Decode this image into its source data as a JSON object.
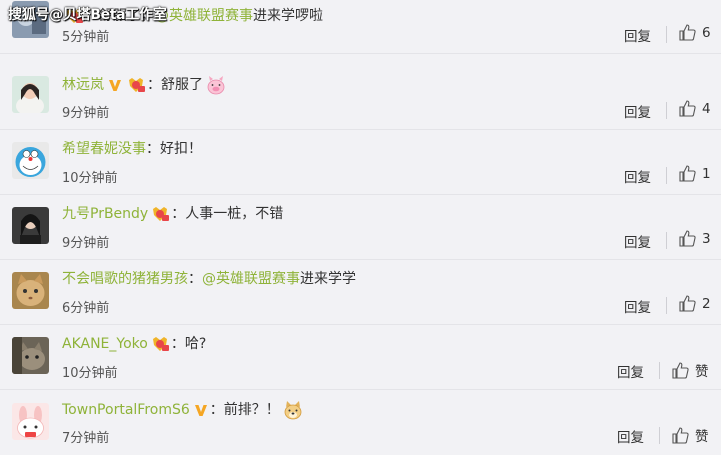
{
  "watermark": "搜狐号@贝塔Beta工作室",
  "reply_label": "回复",
  "comments": [
    {
      "user": "",
      "colon": "：",
      "content_pre": "舒服了，",
      "mention": "@英雄联盟赛事",
      "content_post": " 进来学啰啦",
      "time": "5分钟前",
      "likes": "6"
    },
    {
      "user": "林远岚",
      "colon": "：",
      "content_pre": "舒服了",
      "mention": "",
      "content_post": "",
      "time": "9分钟前",
      "likes": "4"
    },
    {
      "user": "希望春妮没事",
      "colon": "：",
      "content_pre": "好扣！",
      "mention": "",
      "content_post": "",
      "time": "10分钟前",
      "likes": "1"
    },
    {
      "user": "九号PrBendy",
      "colon": "：",
      "content_pre": "人事一桩，不错",
      "mention": "",
      "content_post": "",
      "time": "9分钟前",
      "likes": "3"
    },
    {
      "user": "不会唱歌的猪猪男孩",
      "colon": "：",
      "content_pre": "",
      "mention": "@英雄联盟赛事",
      "content_post": " 进来学学",
      "time": "6分钟前",
      "likes": "2"
    },
    {
      "user": "AKANE_Yoko",
      "colon": "：",
      "content_pre": "哈?",
      "mention": "",
      "content_post": "",
      "time": "10分钟前",
      "likes": "赞"
    },
    {
      "user": "TownPortalFromS6",
      "colon": "：",
      "content_pre": "前排？！",
      "mention": "",
      "content_post": "",
      "time": "7分钟前",
      "likes": "赞"
    }
  ]
}
